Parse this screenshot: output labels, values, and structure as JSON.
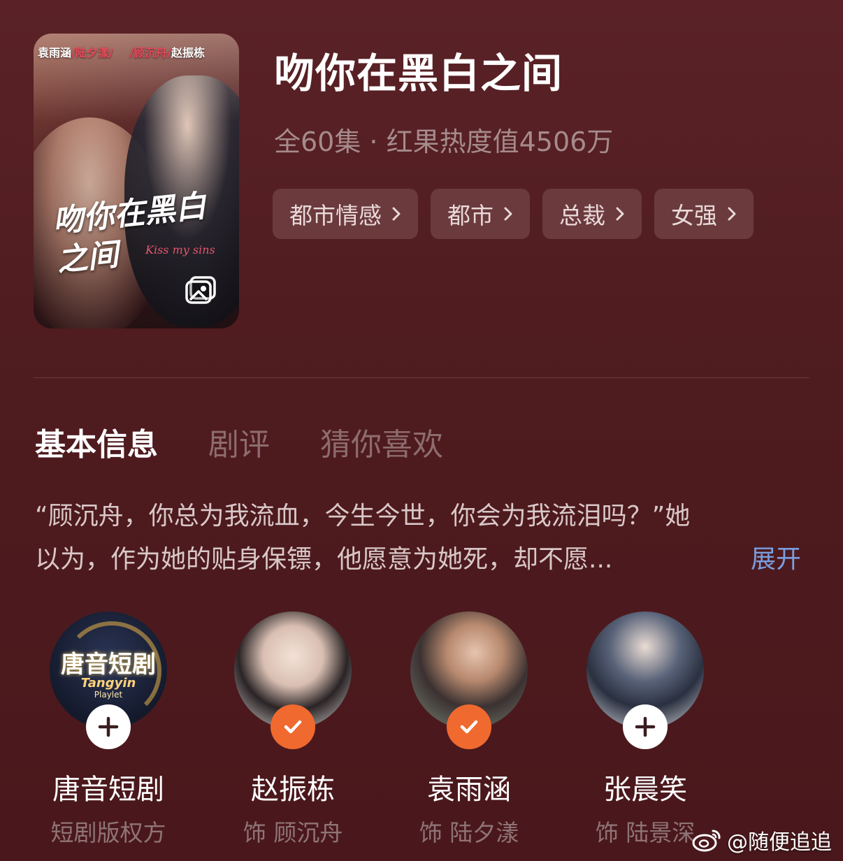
{
  "drama": {
    "title": "吻你在黑白之间",
    "meta": "全60集 · 红果热度值4506万",
    "tags": [
      "都市情感",
      "都市",
      "总裁",
      "女强"
    ]
  },
  "poster": {
    "cast_actress": "袁雨涵",
    "cast_role1": "/陆夕漾/",
    "cast_role2": "/顾沉舟/",
    "cast_actor": "赵振栋",
    "title_art": "吻你在黑白之间",
    "subtitle_art": "Kiss my sins"
  },
  "tabs": [
    "基本信息",
    "剧评",
    "猜你喜欢"
  ],
  "description": {
    "line1": "“顾沉舟，你总为我流血，今生今世，你会为我流泪吗？”她",
    "line2": "以为，作为她的贴身保镖，他愿意为她死，却不愿...",
    "expand": "展开"
  },
  "people": [
    {
      "name": "唐音短剧",
      "role": "短剧版权方",
      "status": "follow",
      "logo_text": "唐音短剧",
      "logo_sub": "Tangyin",
      "logo_sub2": "Playlet"
    },
    {
      "name": "赵振栋",
      "role": "饰 顾沉舟",
      "status": "followed"
    },
    {
      "name": "袁雨涵",
      "role": "饰 陆夕漾",
      "status": "followed"
    },
    {
      "name": "张晨笑",
      "role": "饰 陆景深",
      "status": "follow"
    }
  ],
  "watermark": "@随便追追",
  "colors": {
    "background": "#4c1c1f",
    "followed_badge": "#f0692f",
    "expand_link": "#7a9ee0"
  }
}
